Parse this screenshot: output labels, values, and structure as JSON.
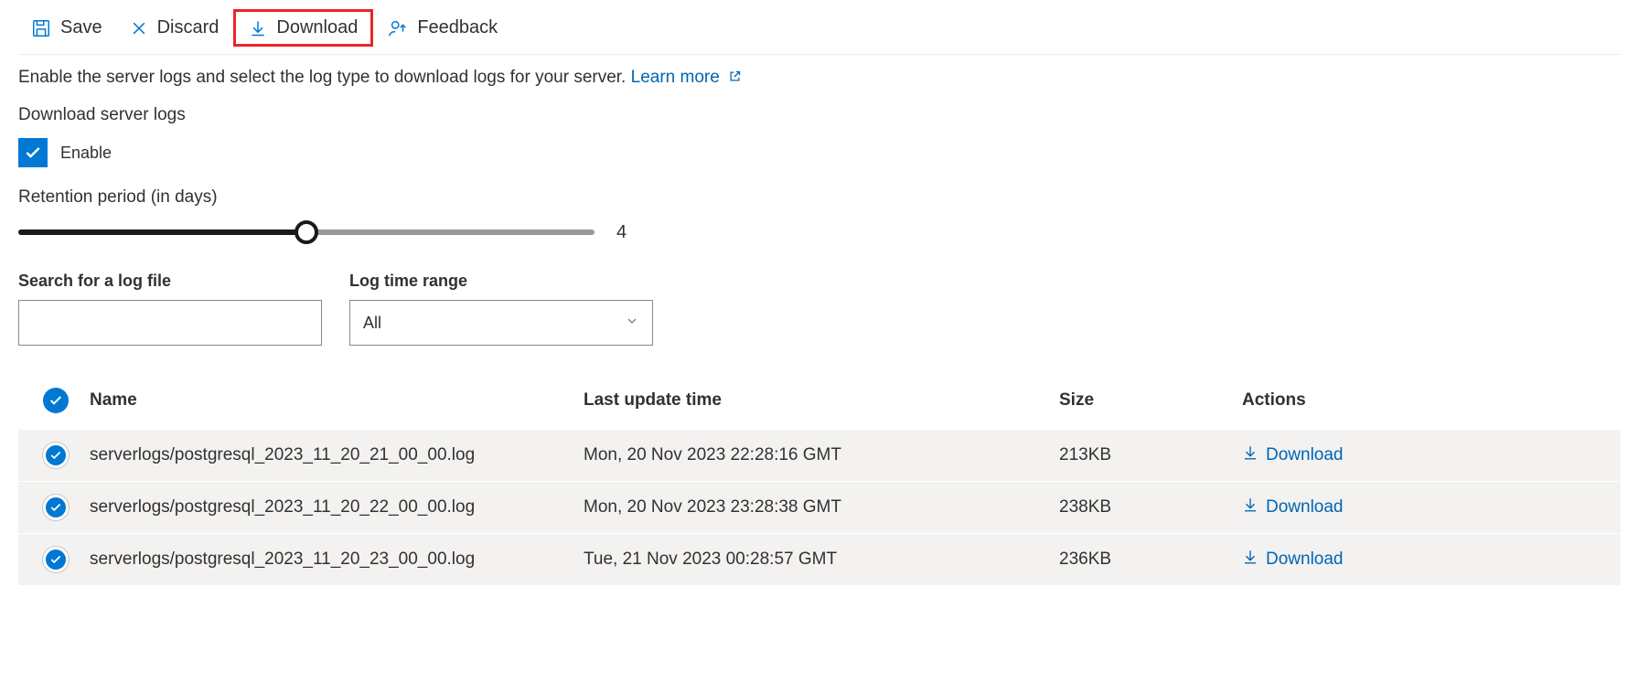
{
  "toolbar": {
    "save": "Save",
    "discard": "Discard",
    "download": "Download",
    "feedback": "Feedback"
  },
  "description": {
    "text": "Enable the server logs and select the log type to download logs for your server.",
    "link": "Learn more"
  },
  "download_section_label": "Download server logs",
  "enable_label": "Enable",
  "retention_label": "Retention period (in days)",
  "retention_value": "4",
  "retention_percent": 50,
  "filters": {
    "search_label": "Search for a log file",
    "search_value": "",
    "range_label": "Log time range",
    "range_value": "All"
  },
  "table": {
    "headers": {
      "name": "Name",
      "last_update": "Last update time",
      "size": "Size",
      "actions": "Actions"
    },
    "action_label": "Download",
    "rows": [
      {
        "name": "serverlogs/postgresql_2023_11_20_21_00_00.log",
        "time": "Mon, 20 Nov 2023 22:28:16 GMT",
        "size": "213KB"
      },
      {
        "name": "serverlogs/postgresql_2023_11_20_22_00_00.log",
        "time": "Mon, 20 Nov 2023 23:28:38 GMT",
        "size": "238KB"
      },
      {
        "name": "serverlogs/postgresql_2023_11_20_23_00_00.log",
        "time": "Tue, 21 Nov 2023 00:28:57 GMT",
        "size": "236KB"
      }
    ]
  }
}
